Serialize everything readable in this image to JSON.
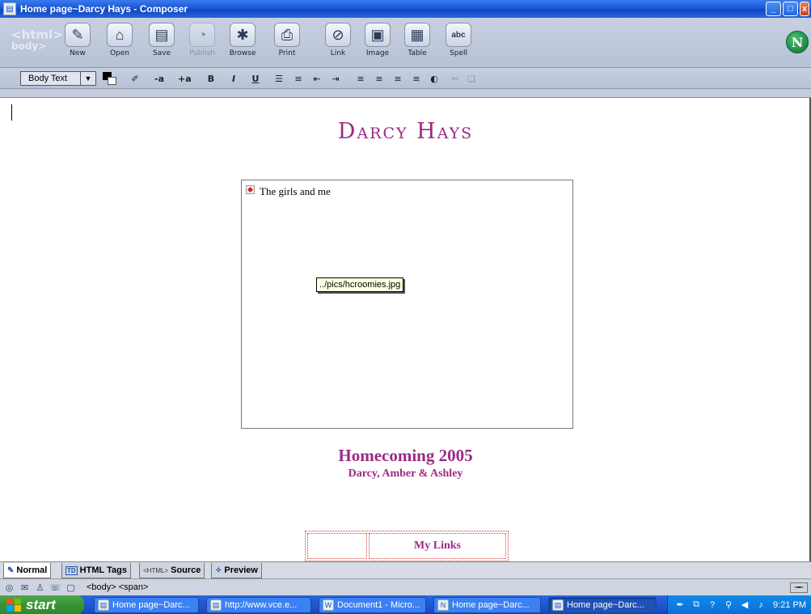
{
  "window": {
    "title": "Home page~Darcy Hays - Composer",
    "buttons": {
      "minimize": "_",
      "maximize": "□",
      "close": "x"
    }
  },
  "main_toolbar": {
    "html_logo": "<html>",
    "body_logo": "body>",
    "buttons": [
      {
        "label": "New",
        "icon": "new-page-icon",
        "glyph": "✎"
      },
      {
        "label": "Open",
        "icon": "folder-open-icon",
        "glyph": "⌂"
      },
      {
        "label": "Save",
        "icon": "save-icon",
        "glyph": "▤"
      },
      {
        "label": "Publish",
        "icon": "publish-icon",
        "glyph": "◔",
        "disabled": true
      },
      {
        "label": "Browse",
        "icon": "browse-icon",
        "glyph": "✱"
      },
      {
        "label": "Print",
        "icon": "print-icon",
        "glyph": "⎙"
      },
      {
        "label": "Link",
        "icon": "link-icon",
        "glyph": "⊘"
      },
      {
        "label": "Image",
        "icon": "image-icon",
        "glyph": "▣"
      },
      {
        "label": "Table",
        "icon": "table-icon",
        "glyph": "▦"
      },
      {
        "label": "Spell",
        "icon": "spell-icon",
        "glyph": "abc"
      }
    ],
    "brand_logo": "N"
  },
  "format_toolbar": {
    "paragraph_format": "Body Text",
    "buttons": [
      {
        "name": "highlight-button",
        "glyph": "✐"
      },
      {
        "name": "decrease-font-button",
        "glyph": "-a"
      },
      {
        "name": "increase-font-button",
        "glyph": "+a"
      },
      {
        "name": "bold-button",
        "glyph": "B"
      },
      {
        "name": "italic-button",
        "glyph": "I"
      },
      {
        "name": "underline-button",
        "glyph": "U"
      },
      {
        "name": "bulleted-list-button",
        "glyph": "☰"
      },
      {
        "name": "numbered-list-button",
        "glyph": "≡"
      },
      {
        "name": "outdent-button",
        "glyph": "⇤"
      },
      {
        "name": "indent-button",
        "glyph": "⇥"
      },
      {
        "name": "align-left-button",
        "glyph": "≡"
      },
      {
        "name": "align-center-button",
        "glyph": "≡"
      },
      {
        "name": "align-right-button",
        "glyph": "≡"
      },
      {
        "name": "justify-button",
        "glyph": "≡"
      },
      {
        "name": "anchor-button",
        "glyph": "◐"
      },
      {
        "name": "remove-link-button",
        "glyph": "✂"
      },
      {
        "name": "table-props-button",
        "glyph": "❏"
      }
    ],
    "text_color": "#000000",
    "background_color": "#ffffff"
  },
  "document": {
    "title": "Darcy Hays",
    "image_alt": "The girls and me",
    "image_tooltip": "../pics/hcroomies.jpg",
    "caption": "Homecoming 2005",
    "subcaption": "Darcy, Amber & Ashley",
    "links_header": "My Links",
    "accent_color": "#9b2a86"
  },
  "mode_tabs": [
    {
      "label": "Normal",
      "icon": "normal-mode-icon",
      "glyph": "✎",
      "active": true
    },
    {
      "label": "HTML Tags",
      "icon": "html-tags-icon",
      "glyph": "TD"
    },
    {
      "label": "Source",
      "icon": "source-icon",
      "glyph": "<HTML>"
    },
    {
      "label": "Preview",
      "icon": "preview-icon",
      "glyph": "✧"
    }
  ],
  "status_bar": {
    "tag_path": "<body> <span>",
    "icons": [
      "navigator-icon",
      "mail-icon",
      "address-book-icon",
      "chat-icon",
      "composer-icon"
    ]
  },
  "taskbar": {
    "start_label": "start",
    "tasks": [
      {
        "label": "Home page~Darc...",
        "icon": "composer-icon"
      },
      {
        "label": "http://www.vce.e...",
        "icon": "composer-icon"
      },
      {
        "label": "Document1 - Micro...",
        "icon": "word-icon"
      },
      {
        "label": "Home page~Darc...",
        "icon": "netscape-icon"
      },
      {
        "label": "Home page~Darc...",
        "icon": "composer-icon",
        "active": true
      }
    ],
    "clock": "9:21 PM"
  }
}
